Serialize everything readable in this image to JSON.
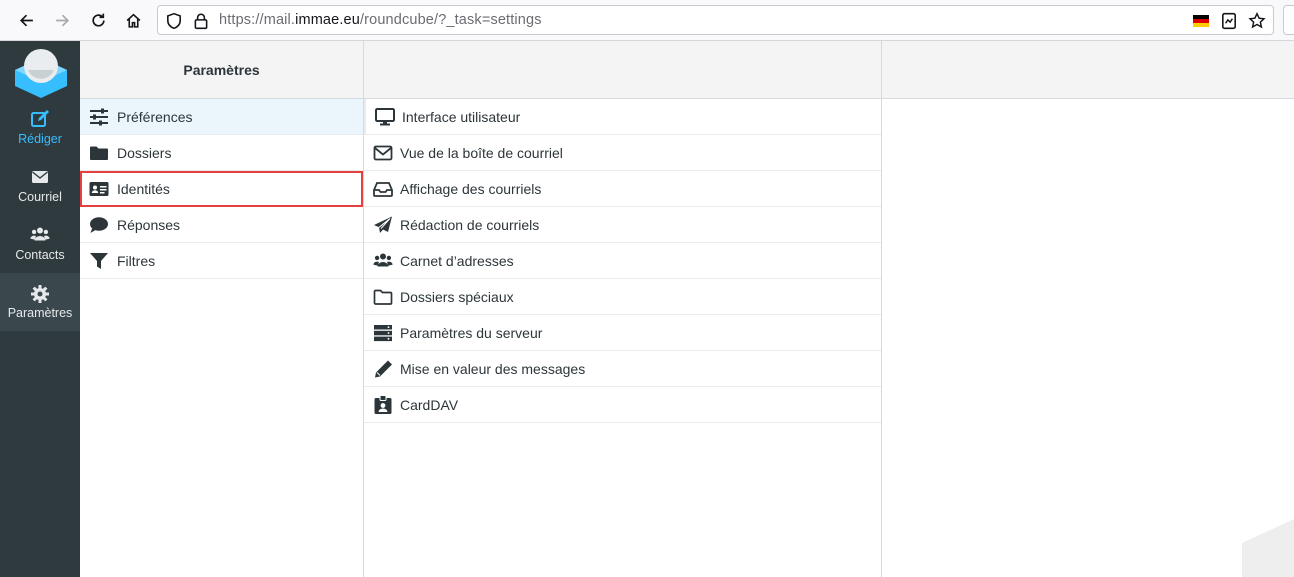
{
  "browser": {
    "url_prefix": "https://mail.",
    "url_host": "immae.eu",
    "url_path": "/roundcube/?_task=settings",
    "icons": [
      "back-arrow-icon",
      "forward-arrow-icon",
      "reload-icon",
      "home-icon",
      "shield-icon",
      "lock-icon",
      "german-flag-icon",
      "reader-view-icon",
      "bookmark-star-icon"
    ]
  },
  "nav": {
    "items": [
      {
        "label": "Rédiger",
        "icon": "edit-icon"
      },
      {
        "label": "Courriel",
        "icon": "envelope-icon"
      },
      {
        "label": "Contacts",
        "icon": "users-icon"
      },
      {
        "label": "Paramètres",
        "icon": "gear-icon"
      }
    ],
    "colors": {
      "background": "#2f3a3f",
      "accent": "#37beff"
    }
  },
  "settings": {
    "title": "Paramètres",
    "items": [
      {
        "label": "Préférences",
        "icon": "sliders-icon",
        "selected": true
      },
      {
        "label": "Dossiers",
        "icon": "folder-icon"
      },
      {
        "label": "Identités",
        "icon": "id-card-icon",
        "highlighted": true
      },
      {
        "label": "Réponses",
        "icon": "comment-icon"
      },
      {
        "label": "Filtres",
        "icon": "filter-icon"
      }
    ]
  },
  "sections": {
    "items": [
      {
        "label": "Interface utilisateur",
        "icon": "desktop-icon"
      },
      {
        "label": "Vue de la boîte de courriel",
        "icon": "envelope-outline-icon"
      },
      {
        "label": "Affichage des courriels",
        "icon": "inbox-icon"
      },
      {
        "label": "Rédaction de courriels",
        "icon": "paper-plane-icon"
      },
      {
        "label": "Carnet d’adresses",
        "icon": "users-icon"
      },
      {
        "label": "Dossiers spéciaux",
        "icon": "folder-outline-icon"
      },
      {
        "label": "Paramètres du serveur",
        "icon": "server-icon"
      },
      {
        "label": "Mise en valeur des messages",
        "icon": "pencil-icon"
      },
      {
        "label": "CardDAV",
        "icon": "id-badge-icon"
      }
    ]
  }
}
